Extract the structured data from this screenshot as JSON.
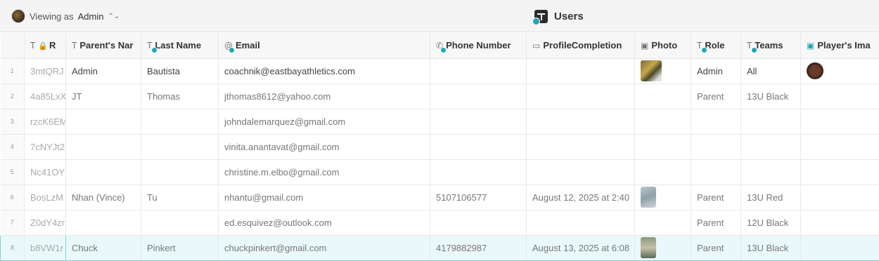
{
  "header": {
    "viewing_prefix": "Viewing as",
    "viewing_name": "Admin",
    "table_title": "Users"
  },
  "columns": [
    {
      "label": "R",
      "icon": "text-icon"
    },
    {
      "label": "Parent's Nar",
      "icon": "text-icon"
    },
    {
      "label": "Last Name",
      "icon": "text-user-icon"
    },
    {
      "label": "Email",
      "icon": "email-user-icon"
    },
    {
      "label": "Phone Number",
      "icon": "phone-user-icon"
    },
    {
      "label": "ProfileCompletion",
      "icon": "calendar-icon"
    },
    {
      "label": "Photo",
      "icon": "image-icon"
    },
    {
      "label": "Role",
      "icon": "text-user-icon"
    },
    {
      "label": "Teams",
      "icon": "text-user-icon"
    },
    {
      "label": "Player's Ima",
      "icon": "image-teal-icon"
    }
  ],
  "rows": [
    {
      "num": "1",
      "id": "3mtQRJ",
      "parent": "Admin",
      "last": "Bautista",
      "email": "coachnik@eastbayathletics.com",
      "phone": "",
      "completion": "",
      "role": "Admin",
      "teams": "All"
    },
    {
      "num": "2",
      "id": "4a85LxX",
      "parent": "JT",
      "last": "Thomas",
      "email": "jthomas8612@yahoo.com",
      "phone": "",
      "completion": "",
      "role": "Parent",
      "teams": "13U Black"
    },
    {
      "num": "3",
      "id": "rzcK6EM",
      "parent": "",
      "last": "",
      "email": "johndalemarquez@gmail.com",
      "phone": "",
      "completion": "",
      "role": "",
      "teams": ""
    },
    {
      "num": "4",
      "id": "7cNYJt2",
      "parent": "",
      "last": "",
      "email": "vinita.anantavat@gmail.com",
      "phone": "",
      "completion": "",
      "role": "",
      "teams": ""
    },
    {
      "num": "5",
      "id": "Nc41OY",
      "parent": "",
      "last": "",
      "email": "christine.m.elbo@gmail.com",
      "phone": "",
      "completion": "",
      "role": "",
      "teams": ""
    },
    {
      "num": "6",
      "id": "BosLzM",
      "parent": "Nhan (Vince)",
      "last": "Tu",
      "email": "nhantu@gmail.com",
      "phone": "5107106577",
      "completion": "August 12, 2025 at 2:40",
      "role": "Parent",
      "teams": "13U Red"
    },
    {
      "num": "7",
      "id": "Z0dY4zr",
      "parent": "",
      "last": "",
      "email": "ed.esquivez@outlook.com",
      "phone": "",
      "completion": "",
      "role": "Parent",
      "teams": "12U Black"
    },
    {
      "num": "8",
      "id": "b8VW1r",
      "parent": "Chuck",
      "last": "Pinkert",
      "email": "chuckpinkert@gmail.com",
      "phone": "4179882987",
      "completion": "August 13, 2025 at 6:08",
      "role": "Parent",
      "teams": "13U Black"
    }
  ]
}
